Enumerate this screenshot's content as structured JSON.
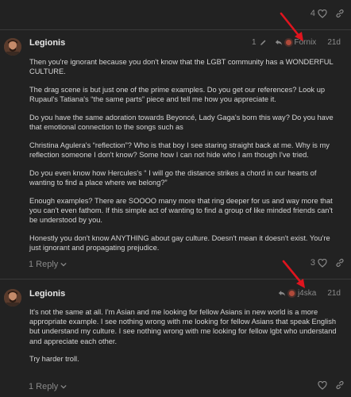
{
  "top_actions": {
    "like_count": "4",
    "like_icon": "heart-icon",
    "link_icon": "link-icon"
  },
  "posts": [
    {
      "username": "Legionis",
      "edit_indicator": "1",
      "reply_to_user": "Fornix",
      "date": "21d",
      "paragraphs": [
        "Then you're ignorant because you don't know that the LGBT community has a WONDERFUL CULTURE.",
        "The drag scene is but just one of the prime examples. Do you get our references? Look up Rupaul's Tatiana's “the same parts” piece and tell me how you appreciate it.",
        "Do you have the same adoration towards Beyoncé, Lady Gaga's born this way? Do you have that emotional connection to the songs such as",
        "Christina Agulera's “reflection”? Who is that boy I see staring straight back at me. Why is my reflection someone I don't know? Some how I can not hide who I am though I've tried.",
        "Do you even know how Hercules's “ I will go the distance strikes a chord in our hearts of wanting to find a place where we belong?”",
        "Enough examples? There are SOOOO many more that ring deeper for us and way more that you can't even fathom. If this simple act of wanting to find a group of like minded friends can't be understood by you.",
        "Honestly you don't know ANYTHING about gay culture. Doesn't mean it doesn't exist. You're just ignorant and propagating prejudice."
      ],
      "reply_label": "1 Reply",
      "like_count": "3"
    },
    {
      "username": "Legionis",
      "reply_to_user": "j4ska",
      "date": "21d",
      "paragraphs": [
        "It's not the same at all. I'm Asian and me looking for fellow Asians in new world is a more appropriate example. I see nothing wrong with me looking for fellow Asians that speak English but understand my culture. I see nothing wrong with me looking for fellow lgbt who understand and appreciate each other.",
        "Try harder troll."
      ],
      "reply_label": "1 Reply",
      "like_count": ""
    }
  ],
  "colors": {
    "background": "#222222",
    "text": "#d6d6d6",
    "muted": "#8a8a8a",
    "arrow": "#e0141e"
  }
}
